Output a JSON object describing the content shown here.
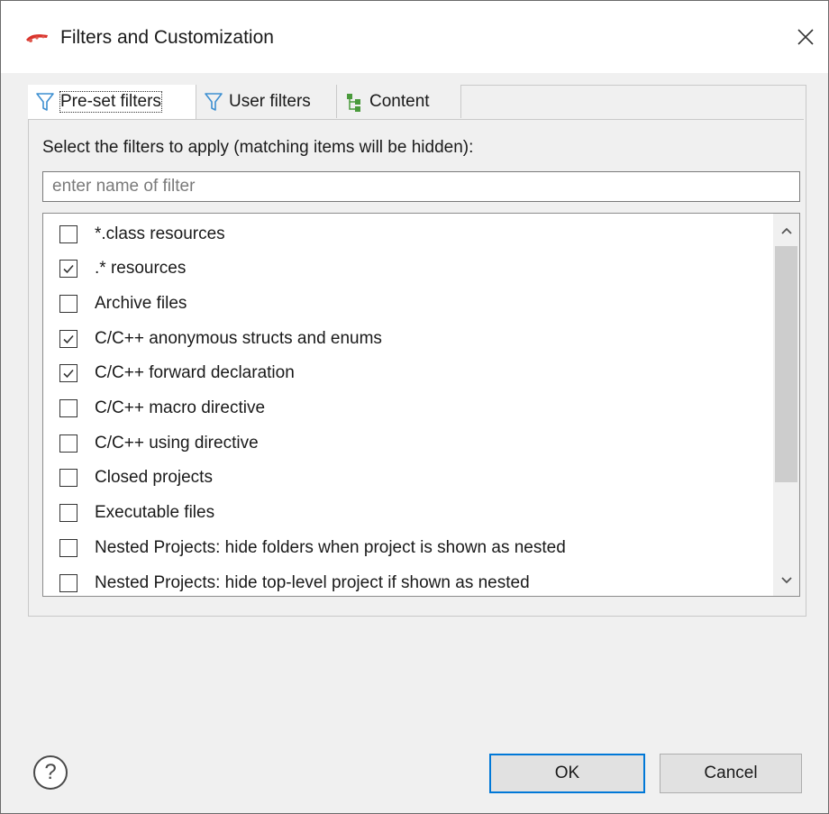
{
  "window": {
    "title": "Filters and Customization",
    "app_icon": "eclipse-app-icon",
    "close_icon": "close-icon"
  },
  "tabs": [
    {
      "label": "Pre-set filters",
      "icon": "filter-icon",
      "active": true
    },
    {
      "label": "User filters",
      "icon": "filter-icon",
      "active": false
    },
    {
      "label": "Content",
      "icon": "content-tree-icon",
      "active": false
    }
  ],
  "panel": {
    "instruction": "Select the filters to apply (matching items will be hidden):",
    "filter_placeholder": "enter name of filter",
    "filter_value": ""
  },
  "filters": [
    {
      "label": "*.class resources",
      "checked": false
    },
    {
      "label": ".* resources",
      "checked": true
    },
    {
      "label": "Archive files",
      "checked": false
    },
    {
      "label": "C/C++ anonymous structs and enums",
      "checked": true
    },
    {
      "label": "C/C++ forward declaration",
      "checked": true
    },
    {
      "label": "C/C++ macro directive",
      "checked": false
    },
    {
      "label": "C/C++ using directive",
      "checked": false
    },
    {
      "label": "Closed projects",
      "checked": false
    },
    {
      "label": "Executable files",
      "checked": false
    },
    {
      "label": "Nested Projects: hide folders when project is shown as nested",
      "checked": false
    },
    {
      "label": "Nested Projects: hide top-level project if shown as nested",
      "checked": false
    }
  ],
  "scroll": {
    "up_icon": "chevron-up-icon",
    "down_icon": "chevron-down-icon"
  },
  "footer": {
    "help_symbol": "?",
    "ok_label": "OK",
    "cancel_label": "Cancel"
  },
  "colors": {
    "accent": "#0078d7",
    "dialog_bg": "#f0f0f0",
    "thumb": "#cdcdcd"
  }
}
